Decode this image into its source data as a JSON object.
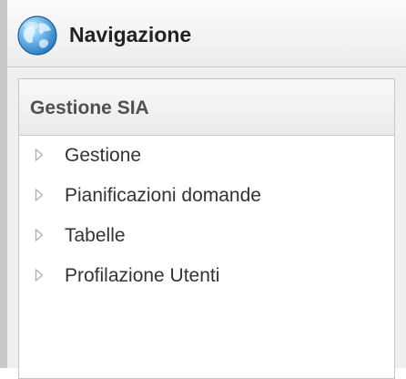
{
  "navigation": {
    "title": "Navigazione",
    "icon": "globe-icon"
  },
  "section": {
    "title": "Gestione SIA",
    "items": [
      {
        "label": "Gestione",
        "icon": "chevron-right-icon"
      },
      {
        "label": "Pianificazioni domande",
        "icon": "chevron-right-icon"
      },
      {
        "label": "Tabelle",
        "icon": "chevron-right-icon"
      },
      {
        "label": "Profilazione Utenti",
        "icon": "chevron-right-icon"
      }
    ]
  },
  "colors": {
    "globe_light": "#9fd2f2",
    "globe_dark": "#1f6fb3",
    "arrow": "#b3b3b3"
  }
}
